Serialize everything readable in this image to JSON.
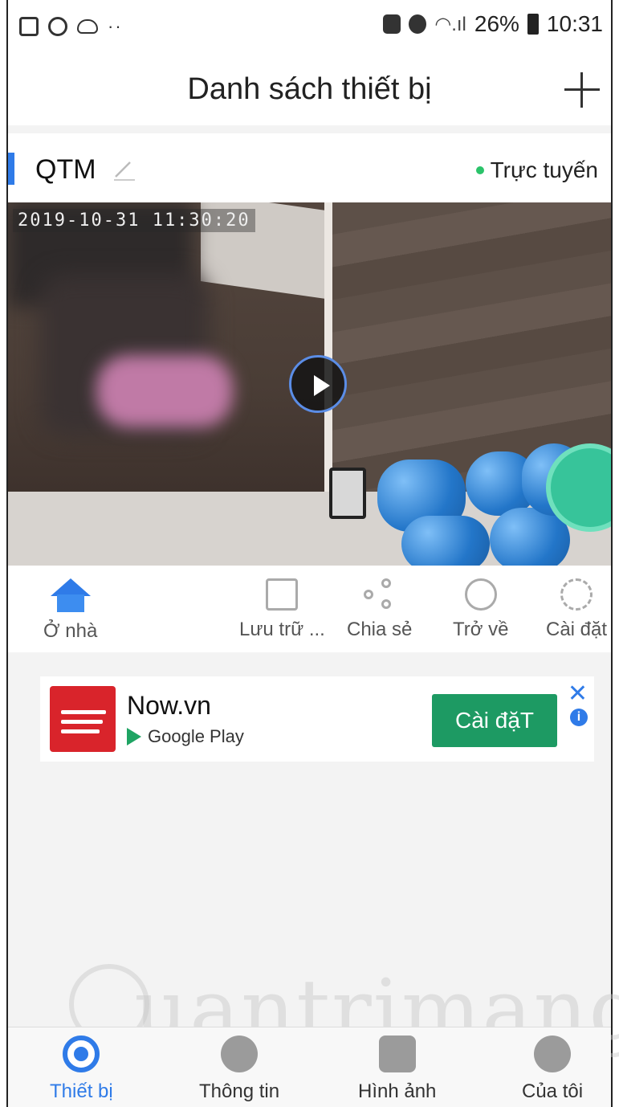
{
  "status_bar": {
    "battery": "26%",
    "time": "10:31",
    "dots": "··"
  },
  "header": {
    "title": "Danh sách thiết bị"
  },
  "device": {
    "name": "QTM",
    "status": "Trực tuyến",
    "timestamp": "2019-10-31 11:30:20",
    "actions": [
      {
        "label": "Ở nhà",
        "icon": "home-icon"
      },
      {
        "label": "Lưu trữ ...",
        "icon": "storage-icon"
      },
      {
        "label": "Chia sẻ",
        "icon": "share-icon"
      },
      {
        "label": "Trở về",
        "icon": "playback-icon"
      },
      {
        "label": "Cài đặt",
        "icon": "settings-icon"
      }
    ]
  },
  "ad": {
    "title": "Now.vn",
    "store": "Google Play",
    "button": "Cài đặT",
    "close": "✕",
    "info": "i"
  },
  "watermark": "uantrimang",
  "tabs": [
    {
      "label": "Thiết bị",
      "icon": "camera-icon",
      "active": true
    },
    {
      "label": "Thông tin",
      "icon": "message-icon",
      "active": false
    },
    {
      "label": "Hình ảnh",
      "icon": "image-icon",
      "active": false
    },
    {
      "label": "Của tôi",
      "icon": "user-icon",
      "active": false
    }
  ],
  "colors": {
    "accent": "#2f7be8",
    "online": "#2bc36a",
    "ad_button": "#1d9a63",
    "ad_logo": "#d9242b"
  }
}
